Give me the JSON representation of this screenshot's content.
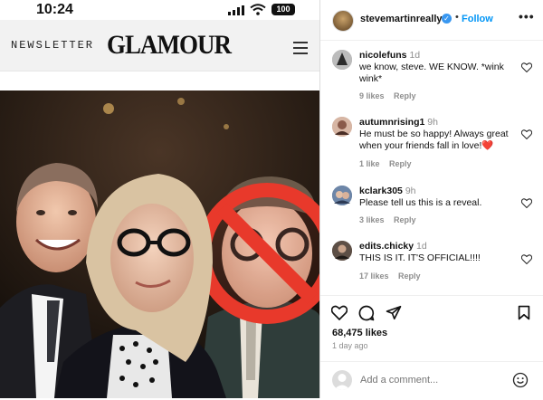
{
  "status_bar": {
    "time": "10:24",
    "battery": "100"
  },
  "site": {
    "newsletter_label": "NEWSLETTER",
    "logo": "GLAMOUR"
  },
  "post": {
    "author": "stevemartinreally",
    "follow_label": "Follow",
    "likes": "68,475 likes",
    "age": "1 day ago"
  },
  "comments": [
    {
      "user": "nicolefuns",
      "time": "1d",
      "text": "we know, steve. WE KNOW. *wink wink*",
      "likes": "9 likes",
      "reply": "Reply"
    },
    {
      "user": "autumnrising1",
      "time": "9h",
      "text": "He must be so happy! Always great when your friends fall in love!❤️",
      "likes": "1 like",
      "reply": "Reply"
    },
    {
      "user": "kclark305",
      "time": "9h",
      "text": "Please tell us this is a reveal.",
      "likes": "3 likes",
      "reply": "Reply"
    },
    {
      "user": "edits.chicky",
      "time": "1d",
      "text": "THIS IS IT. IT'S OFFICIAL!!!!",
      "likes": "17 likes",
      "reply": "Reply"
    }
  ],
  "add_comment": {
    "placeholder": "Add a comment..."
  },
  "colors": {
    "follow": "#0095f6",
    "verified": "#3897f0",
    "prohibit": "#e8392b"
  }
}
